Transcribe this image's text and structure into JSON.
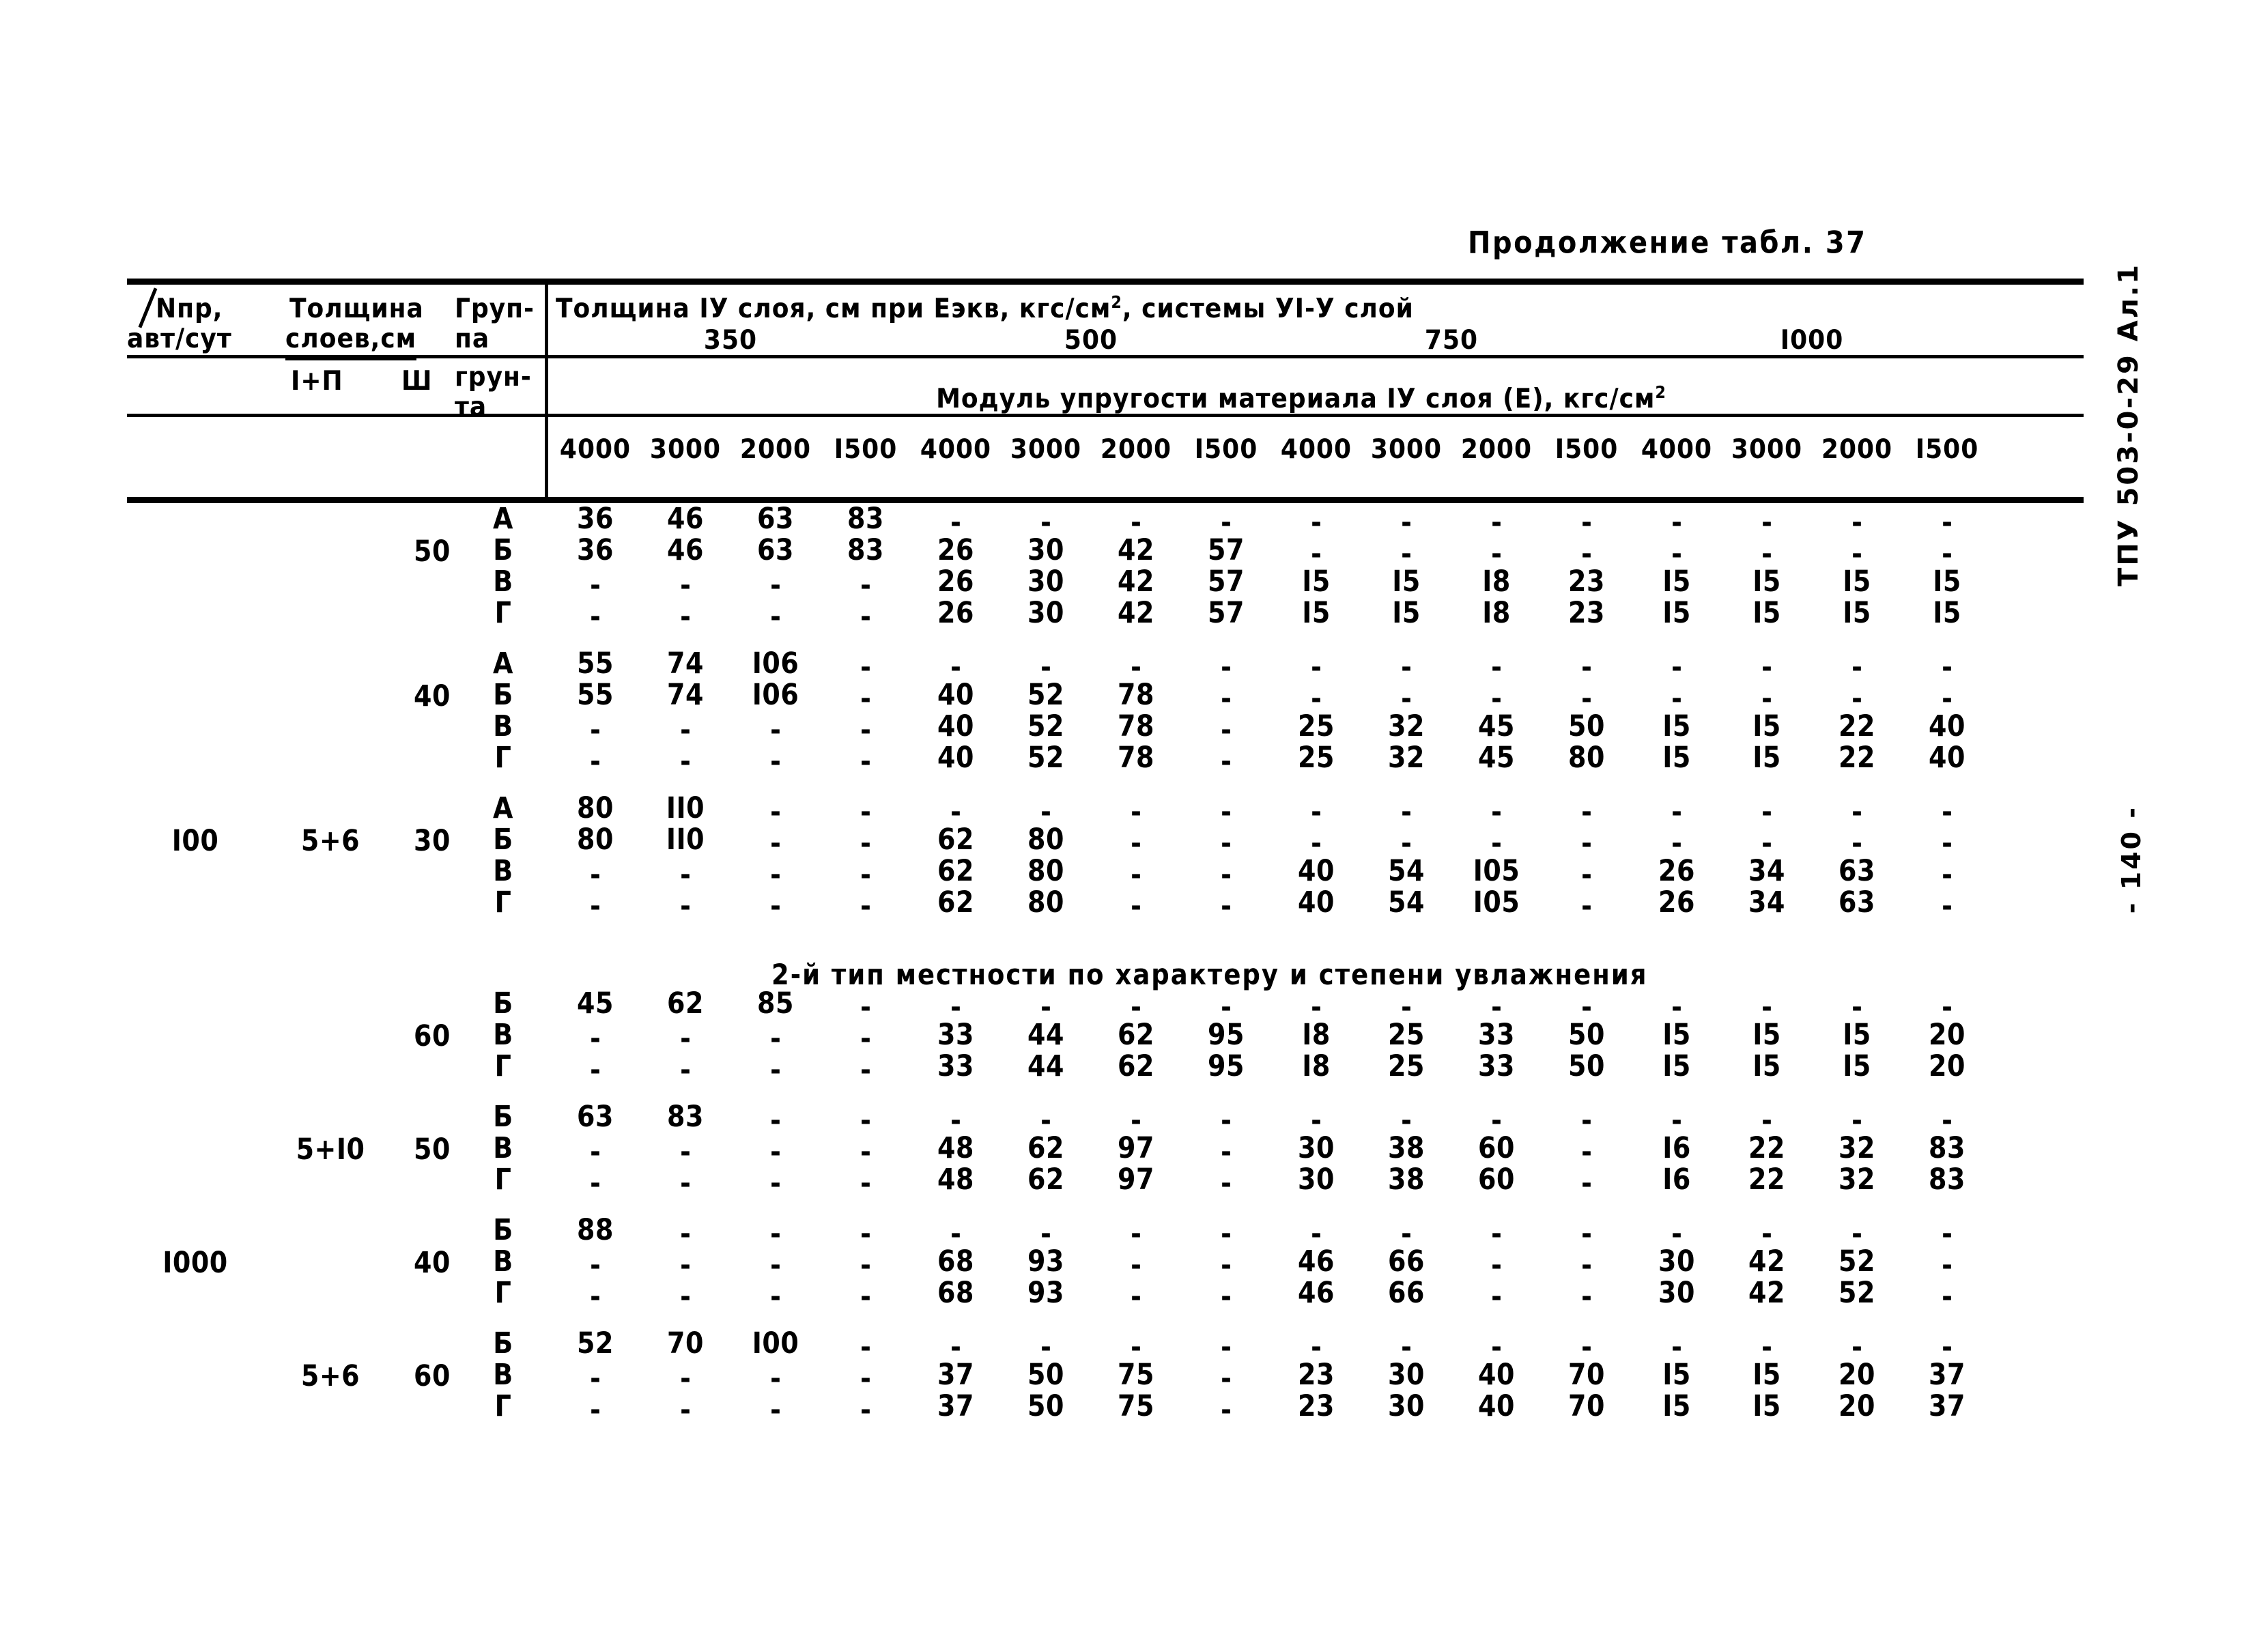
{
  "document": {
    "continuation_label": "Продолжение табл. 37",
    "margin_code": "ТПУ 503-0-29 Ал.1",
    "margin_page": "- 140 -"
  },
  "table": {
    "stub_headers": {
      "traffic_line1": "Nпр,",
      "traffic_line2": "авт/сут",
      "thickness_line1": "Толщина",
      "thickness_line2": "слоев,см",
      "thickness_sub_a": "I+П",
      "thickness_sub_b": "Ш",
      "soil_line1": "Груп-",
      "soil_line2": "па",
      "soil_line3": "грун-",
      "soil_line4": "та"
    },
    "spanner_title_pre": "Толщина IУ слоя, см при Еэкв, кгс/см",
    "spanner_title_sup": "2",
    "spanner_title_post": ", системы УI-У слой",
    "eqv_groups": [
      "350",
      "500",
      "750",
      "I000"
    ],
    "modulus_title_pre": "Модуль упругости материала IУ слоя (Е), кгс/см",
    "modulus_title_sup": "2",
    "modulus_values": [
      "4000",
      "3000",
      "2000",
      "I500"
    ],
    "section_note": "2-й тип местности по характеру и степени увлажнения",
    "dash": "-",
    "blocks": [
      {
        "traffic": "",
        "thickness_ab": "",
        "thickness_c": "50",
        "rows": [
          {
            "soil": "А",
            "values": [
              "36",
              "46",
              "63",
              "83",
              "-",
              "-",
              "-",
              "-",
              "-",
              "-",
              "-",
              "-",
              "-",
              "-",
              "-",
              "-"
            ]
          },
          {
            "soil": "Б",
            "values": [
              "36",
              "46",
              "63",
              "83",
              "26",
              "30",
              "42",
              "57",
              "-",
              "-",
              "-",
              "-",
              "-",
              "-",
              "-",
              "-"
            ]
          },
          {
            "soil": "В",
            "values": [
              "-",
              "-",
              "-",
              "-",
              "26",
              "30",
              "42",
              "57",
              "I5",
              "I5",
              "I8",
              "23",
              "I5",
              "I5",
              "I5",
              "I5"
            ]
          },
          {
            "soil": "Г",
            "values": [
              "-",
              "-",
              "-",
              "-",
              "26",
              "30",
              "42",
              "57",
              "I5",
              "I5",
              "I8",
              "23",
              "I5",
              "I5",
              "I5",
              "I5"
            ]
          }
        ]
      },
      {
        "traffic": "",
        "thickness_ab": "",
        "thickness_c": "40",
        "rows": [
          {
            "soil": "А",
            "values": [
              "55",
              "74",
              "I06",
              "-",
              "-",
              "-",
              "-",
              "-",
              "-",
              "-",
              "-",
              "-",
              "-",
              "-",
              "-",
              "-"
            ]
          },
          {
            "soil": "Б",
            "values": [
              "55",
              "74",
              "I06",
              "-",
              "40",
              "52",
              "78",
              "-",
              "-",
              "-",
              "-",
              "-",
              "-",
              "-",
              "-",
              "-"
            ]
          },
          {
            "soil": "В",
            "values": [
              "-",
              "-",
              "-",
              "-",
              "40",
              "52",
              "78",
              "-",
              "25",
              "32",
              "45",
              "50",
              "I5",
              "I5",
              "22",
              "40"
            ]
          },
          {
            "soil": "Г",
            "values": [
              "-",
              "-",
              "-",
              "-",
              "40",
              "52",
              "78",
              "-",
              "25",
              "32",
              "45",
              "80",
              "I5",
              "I5",
              "22",
              "40"
            ]
          }
        ]
      },
      {
        "traffic": "I00",
        "thickness_ab": "5+6",
        "thickness_c": "30",
        "rows": [
          {
            "soil": "А",
            "values": [
              "80",
              "II0",
              "-",
              "-",
              "-",
              "-",
              "-",
              "-",
              "-",
              "-",
              "-",
              "-",
              "-",
              "-",
              "-",
              "-"
            ]
          },
          {
            "soil": "Б",
            "values": [
              "80",
              "II0",
              "-",
              "-",
              "62",
              "80",
              "-",
              "-",
              "-",
              "-",
              "-",
              "-",
              "-",
              "-",
              "-",
              "-"
            ]
          },
          {
            "soil": "В",
            "values": [
              "-",
              "-",
              "-",
              "-",
              "62",
              "80",
              "-",
              "-",
              "40",
              "54",
              "I05",
              "-",
              "26",
              "34",
              "63",
              "-"
            ]
          },
          {
            "soil": "Г",
            "values": [
              "-",
              "-",
              "-",
              "-",
              "62",
              "80",
              "-",
              "-",
              "40",
              "54",
              "I05",
              "-",
              "26",
              "34",
              "63",
              "-"
            ]
          }
        ]
      },
      {
        "traffic": "",
        "thickness_ab": "",
        "thickness_c": "60",
        "rows": [
          {
            "soil": "Б",
            "values": [
              "45",
              "62",
              "85",
              "-",
              "-",
              "-",
              "-",
              "-",
              "-",
              "-",
              "-",
              "-",
              "-",
              "-",
              "-",
              "-"
            ]
          },
          {
            "soil": "В",
            "values": [
              "-",
              "-",
              "-",
              "-",
              "33",
              "44",
              "62",
              "95",
              "I8",
              "25",
              "33",
              "50",
              "I5",
              "I5",
              "I5",
              "20"
            ]
          },
          {
            "soil": "Г",
            "values": [
              "-",
              "-",
              "-",
              "-",
              "33",
              "44",
              "62",
              "95",
              "I8",
              "25",
              "33",
              "50",
              "I5",
              "I5",
              "I5",
              "20"
            ]
          }
        ]
      },
      {
        "traffic": "",
        "thickness_ab": "5+I0",
        "thickness_c": "50",
        "rows": [
          {
            "soil": "Б",
            "values": [
              "63",
              "83",
              "-",
              "-",
              "-",
              "-",
              "-",
              "-",
              "-",
              "-",
              "-",
              "-",
              "-",
              "-",
              "-",
              "-"
            ]
          },
          {
            "soil": "В",
            "values": [
              "-",
              "-",
              "-",
              "-",
              "48",
              "62",
              "97",
              "-",
              "30",
              "38",
              "60",
              "-",
              "I6",
              "22",
              "32",
              "83"
            ]
          },
          {
            "soil": "Г",
            "values": [
              "-",
              "-",
              "-",
              "-",
              "48",
              "62",
              "97",
              "-",
              "30",
              "38",
              "60",
              "-",
              "I6",
              "22",
              "32",
              "83"
            ]
          }
        ]
      },
      {
        "traffic": "I000",
        "thickness_ab": "",
        "thickness_c": "40",
        "rows": [
          {
            "soil": "Б",
            "values": [
              "88",
              "-",
              "-",
              "-",
              "-",
              "-",
              "-",
              "-",
              "-",
              "-",
              "-",
              "-",
              "-",
              "-",
              "-",
              "-"
            ]
          },
          {
            "soil": "В",
            "values": [
              "-",
              "-",
              "-",
              "-",
              "68",
              "93",
              "-",
              "-",
              "46",
              "66",
              "-",
              "-",
              "30",
              "42",
              "52",
              "-"
            ]
          },
          {
            "soil": "Г",
            "values": [
              "-",
              "-",
              "-",
              "-",
              "68",
              "93",
              "-",
              "-",
              "46",
              "66",
              "-",
              "-",
              "30",
              "42",
              "52",
              "-"
            ]
          }
        ]
      },
      {
        "traffic": "",
        "thickness_ab": "5+6",
        "thickness_c": "60",
        "rows": [
          {
            "soil": "Б",
            "values": [
              "52",
              "70",
              "I00",
              "-",
              "-",
              "-",
              "-",
              "-",
              "-",
              "-",
              "-",
              "-",
              "-",
              "-",
              "-",
              "-"
            ]
          },
          {
            "soil": "В",
            "values": [
              "-",
              "-",
              "-",
              "-",
              "37",
              "50",
              "75",
              "-",
              "23",
              "30",
              "40",
              "70",
              "I5",
              "I5",
              "20",
              "37"
            ]
          },
          {
            "soil": "Г",
            "values": [
              "-",
              "-",
              "-",
              "-",
              "37",
              "50",
              "75",
              "-",
              "23",
              "30",
              "40",
              "70",
              "I5",
              "I5",
              "20",
              "37"
            ]
          }
        ]
      }
    ]
  }
}
